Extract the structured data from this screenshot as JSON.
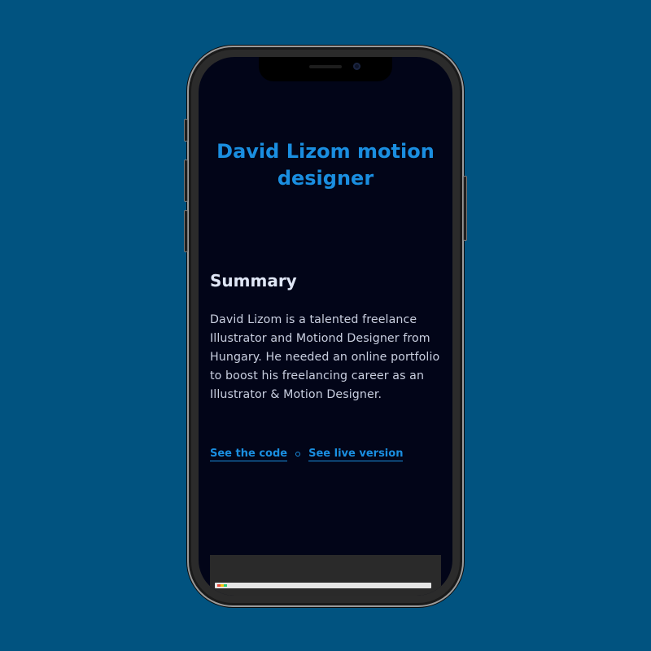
{
  "page": {
    "title": "David Lizom motion designer",
    "summary_heading": "Summary",
    "summary_text": "David Lizom is a talented freelance Illustrator and Motiond Designer from Hungary. He needed an online portfolio to boost his freelancing career as an Illustrator & Motion Designer.",
    "links": {
      "code_label": "See the code",
      "live_label": "See live version"
    }
  },
  "colors": {
    "background": "#015380",
    "screen": "#020518",
    "accent": "#1a8ee0",
    "heading": "#dfe6f5",
    "body_text": "#c9cfe0"
  }
}
